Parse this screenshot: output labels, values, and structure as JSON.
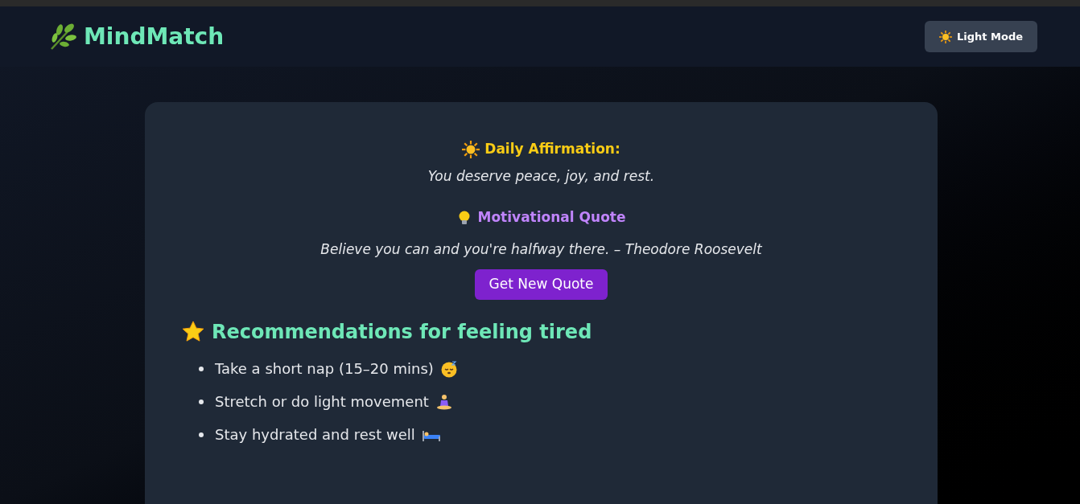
{
  "header": {
    "logo": "MindMatch",
    "theme_button": "Light Mode"
  },
  "affirmation": {
    "title": "Daily Affirmation:",
    "text": "You deserve peace, joy, and rest."
  },
  "quote": {
    "title": "Motivational Quote",
    "text": "Believe you can and you're halfway there. – Theodore Roosevelt",
    "button": "Get New Quote"
  },
  "recommendations": {
    "title": "Recommendations for feeling tired",
    "items": [
      {
        "text": "Take a short nap (15–20 mins)",
        "kind": "sleepy"
      },
      {
        "text": "Stretch or do light movement",
        "kind": "meditate"
      },
      {
        "text": "Stay hydrated and rest well",
        "kind": "bed"
      }
    ]
  }
}
